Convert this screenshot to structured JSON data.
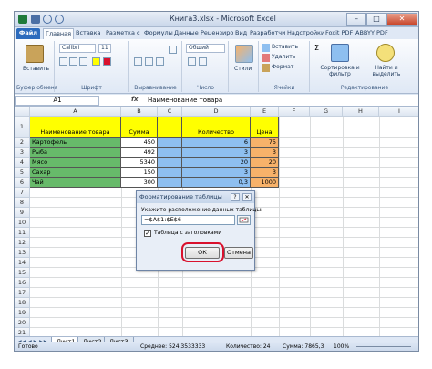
{
  "window": {
    "title": "Книга3.xlsx - Microsoft Excel",
    "controls": {
      "minimize": "–",
      "maximize": "□",
      "close": "✕"
    }
  },
  "ribbon_tabs": [
    "Файл",
    "Главная",
    "Вставка",
    "Разметка с",
    "Формулы",
    "Данные",
    "Рецензиро",
    "Вид",
    "Разработчи",
    "Надстройки",
    "Foxit PDF",
    "ABBYY PDF"
  ],
  "ribbon": {
    "clipboard": {
      "paste": "Вставить",
      "label": "Буфер обмена"
    },
    "font": {
      "name": "Calibri",
      "size": "11",
      "label": "Шрифт"
    },
    "alignment": {
      "label": "Выравнивание"
    },
    "number": {
      "format": "Общий",
      "label": "Число"
    },
    "styles": {
      "button": "Стили"
    },
    "cells": {
      "insert": "Вставить",
      "delete": "Удалить",
      "format": "Формат",
      "label": "Ячейки"
    },
    "editing": {
      "sort": "Сортировка и фильтр",
      "find": "Найти и выделить",
      "label": "Редактирование"
    }
  },
  "formula_bar": {
    "name_box": "A1",
    "fx": "fx",
    "value": "Наименование товара"
  },
  "columns": [
    "A",
    "B",
    "C",
    "D",
    "E",
    "F",
    "G",
    "H",
    "I"
  ],
  "rows": [
    "1",
    "2",
    "3",
    "4",
    "5",
    "6",
    "7",
    "8",
    "9",
    "10",
    "11",
    "12",
    "13",
    "14",
    "15",
    "16",
    "17",
    "18",
    "19",
    "20",
    "21"
  ],
  "table": {
    "headers": {
      "name": "Наименование товара",
      "sum": "Сумма",
      "qty": "Количество",
      "price": "Цена"
    },
    "rows": [
      {
        "name": "Картофель",
        "sum": "450",
        "qty": "6",
        "price": "75"
      },
      {
        "name": "Рыба",
        "sum": "492",
        "qty": "3",
        "price": "3"
      },
      {
        "name": "Мясо",
        "sum": "5340",
        "qty": "20",
        "price": "20"
      },
      {
        "name": "Сахар",
        "sum": "150",
        "qty": "3",
        "price": "3"
      },
      {
        "name": "Чай",
        "sum": "300",
        "qty": "0,3",
        "price": "1000"
      }
    ]
  },
  "dialog": {
    "title": "Форматирование таблицы",
    "help": "?",
    "close": "✕",
    "prompt": "Укажите расположение данных таблицы:",
    "range": "=$A$1:$E$6",
    "checkbox_checked": true,
    "checkbox_mark": "✓",
    "checkbox_label": "Таблица с заголовками",
    "ok": "ОК",
    "cancel": "Отмена"
  },
  "sheets": [
    "Лист1",
    "Лист2",
    "Лист3"
  ],
  "status": {
    "ready": "Готово",
    "average": "Среднее: 524,3533333",
    "count": "Количество: 24",
    "sum": "Сумма: 7865,3",
    "zoom": "100%"
  },
  "colors": {
    "yellow": "#ffff00",
    "green": "#67ba6a",
    "blue": "#8ebff0",
    "orange": "#f7b26a",
    "file_tab": "#2c6bbd",
    "highlight_ring": "#d9112d"
  }
}
